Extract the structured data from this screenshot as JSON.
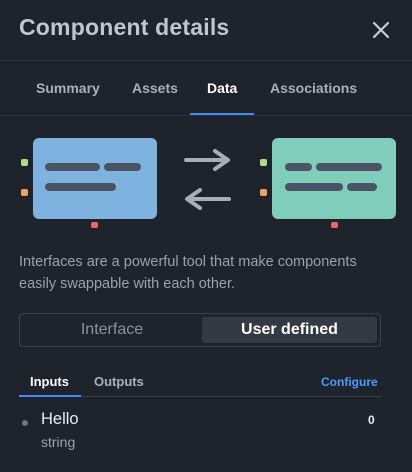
{
  "header": {
    "title": "Component details",
    "close_icon": "close-icon"
  },
  "tabs": [
    {
      "label": "Summary",
      "active": false
    },
    {
      "label": "Assets",
      "active": false
    },
    {
      "label": "Data",
      "active": true
    },
    {
      "label": "Associations",
      "active": false
    }
  ],
  "illustration": {
    "left_card_color": "#7eb3df",
    "right_card_color": "#7fcdbb",
    "bar_color": "#4b5465",
    "arrow_color": "#a8adb6",
    "port_colors": {
      "green": "#b5d98a",
      "orange": "#f0a35e",
      "red": "#e66a6a"
    }
  },
  "description": "Interfaces are a powerful tool that make components easily swappable with each other.",
  "mode_toggle": {
    "options": [
      "Interface",
      "User defined"
    ],
    "selected": "User defined"
  },
  "io_tabs": {
    "inputs_label": "Inputs",
    "outputs_label": "Outputs",
    "active": "Inputs",
    "configure_label": "Configure"
  },
  "inputs": [
    {
      "name": "Hello",
      "type": "string",
      "value": "0"
    }
  ],
  "colors": {
    "accent": "#3d8bff",
    "background": "#1f232c"
  }
}
